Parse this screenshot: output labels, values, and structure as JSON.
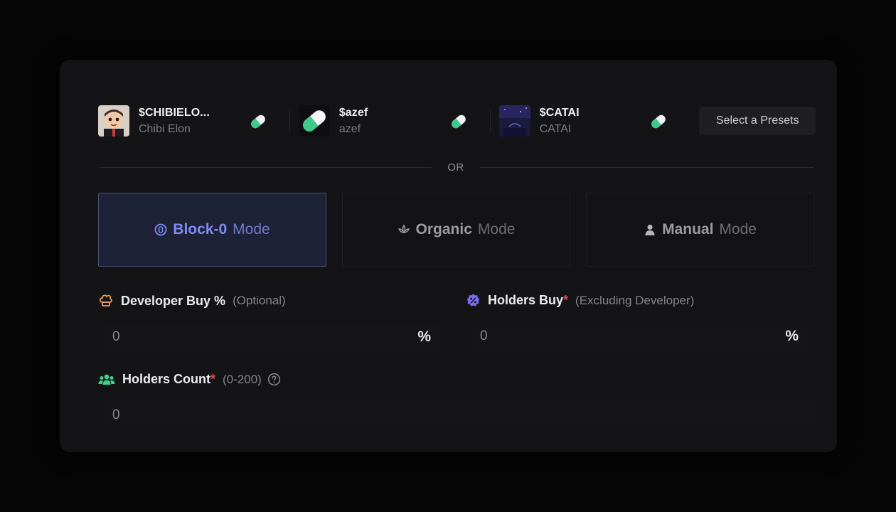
{
  "presets": [
    {
      "symbol": "$CHIBIELO...",
      "name": "Chibi Elon",
      "avatar": "chibi-elon-avatar"
    },
    {
      "symbol": "$azef",
      "name": "azef",
      "avatar": "pill-avatar"
    },
    {
      "symbol": "$CATAI",
      "name": "CATAI",
      "avatar": "catai-avatar"
    }
  ],
  "select_presets_label": "Select a Presets",
  "divider_label": "OR",
  "modes": [
    {
      "title": "Block-0",
      "suffix": "Mode",
      "icon": "coin-icon",
      "active": true
    },
    {
      "title": "Organic",
      "suffix": "Mode",
      "icon": "lotus-icon",
      "active": false
    },
    {
      "title": "Manual",
      "suffix": "Mode",
      "icon": "user-icon",
      "active": false
    }
  ],
  "fields": {
    "developer_buy": {
      "label": "Developer Buy %",
      "hint": "(Optional)",
      "value": "0",
      "unit": "%"
    },
    "holders_buy": {
      "label": "Holders Buy",
      "required": "*",
      "hint": "(Excluding Developer)",
      "value": "0",
      "unit": "%"
    },
    "holders_count": {
      "label": "Holders Count",
      "required": "*",
      "hint": "(0-200)",
      "value": "0"
    }
  },
  "colors": {
    "accent": "#7f8cf3",
    "pill_green": "#3fc98a",
    "required": "#e0494a",
    "chef_icon": "#e7a15a",
    "holders_buy_icon": "#7a6ff0",
    "holders_count_icon": "#3fd08b"
  }
}
